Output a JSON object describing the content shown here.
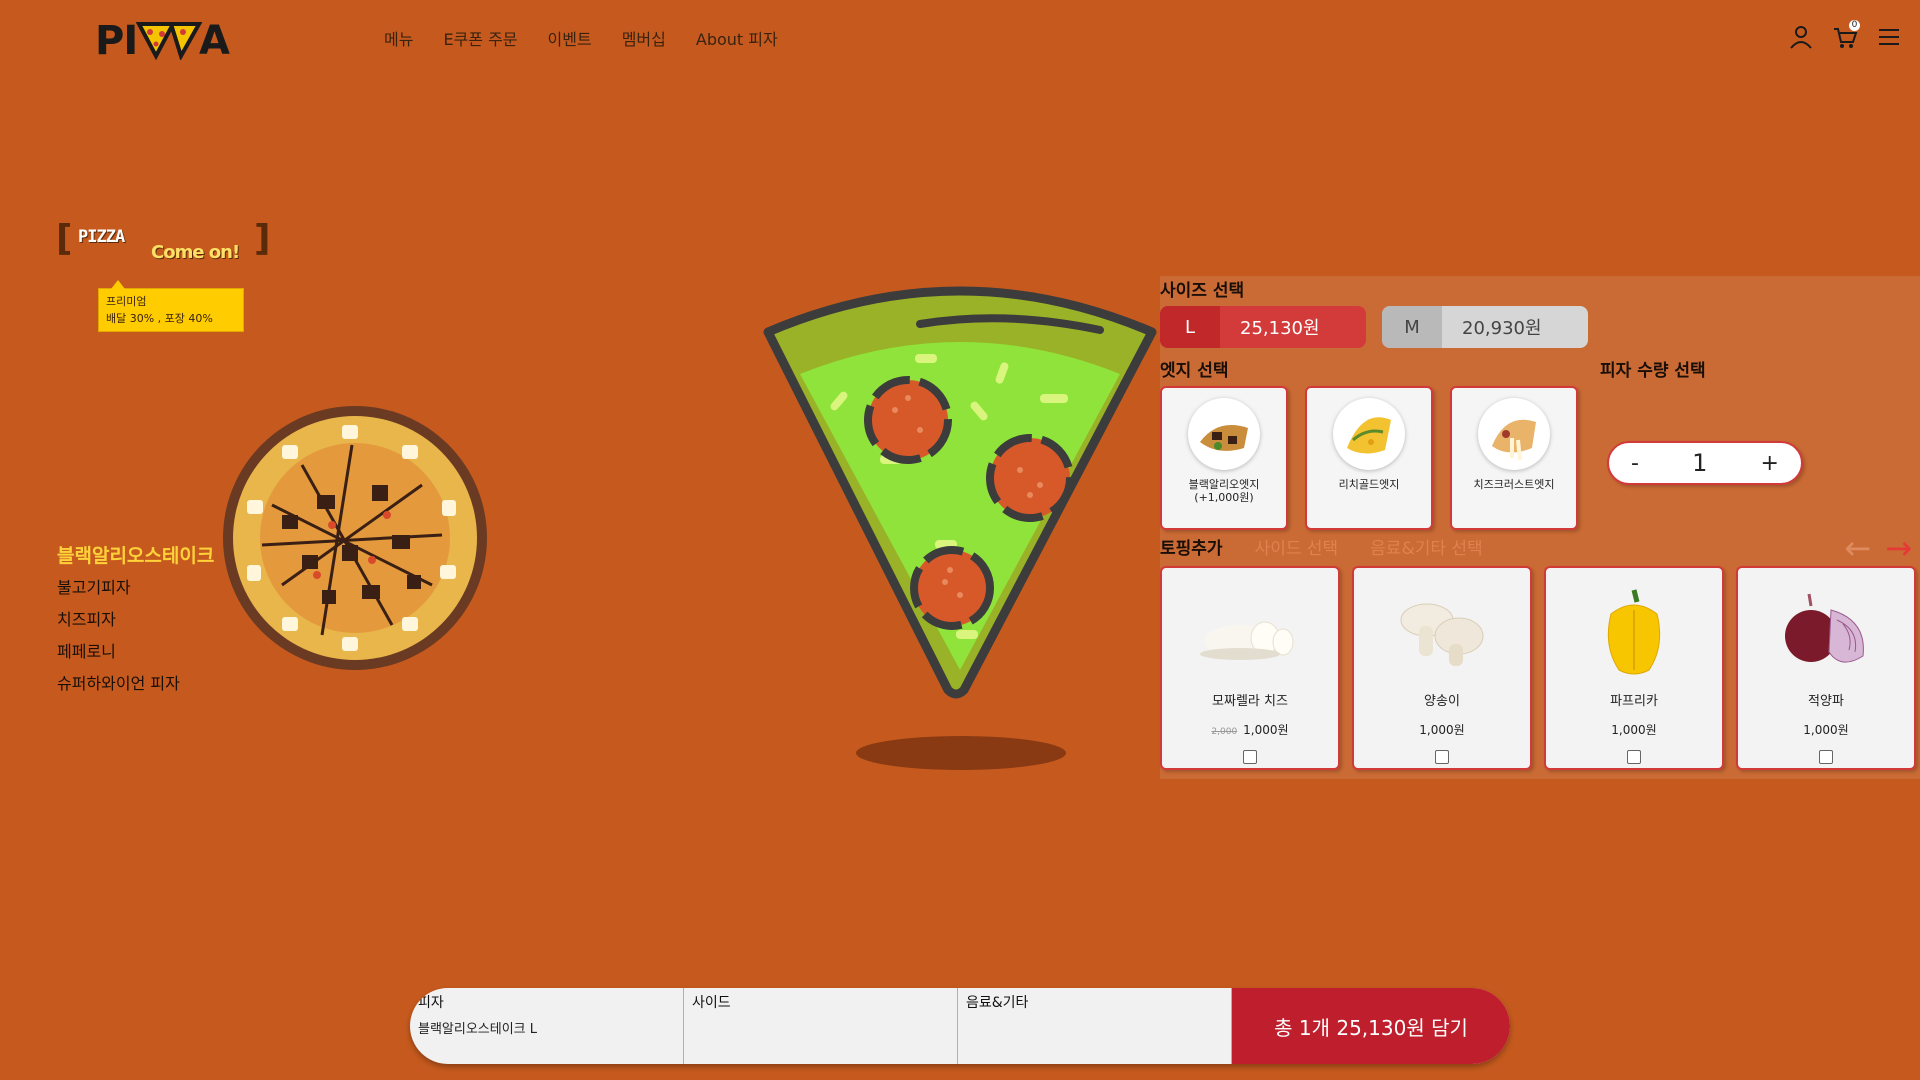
{
  "header": {
    "logo_text": "PIZZA",
    "nav": [
      "메뉴",
      "E쿠폰 주문",
      "이벤트",
      "멤버십",
      "About 피자"
    ],
    "cart_count": "0"
  },
  "promo": {
    "label_pizza": "PIZZA",
    "label_come": "Come on!",
    "tooltip_line1": "프리미엄",
    "tooltip_line2": "배달 30% , 포장 40%"
  },
  "pizza_list": [
    "블랙알리오스테이크",
    "불고기피자",
    "치즈피자",
    "페페로니",
    "슈퍼하와이언 피자"
  ],
  "size": {
    "title": "사이즈 선택",
    "options": [
      {
        "label": "L",
        "price": "25,130원"
      },
      {
        "label": "M",
        "price": "20,930원"
      }
    ]
  },
  "edge": {
    "title": "엣지 선택",
    "options": [
      {
        "name": "블랙알리오엣지",
        "extra": "(+1,000원)"
      },
      {
        "name": "리치골드엣지",
        "extra": ""
      },
      {
        "name": "치즈크러스트엣지",
        "extra": ""
      }
    ]
  },
  "quantity": {
    "title": "피자 수량 선택",
    "minus": "-",
    "value": "1",
    "plus": "+"
  },
  "tabs": [
    "토핑추가",
    "사이드 선택",
    "음료&기타 선택"
  ],
  "arrows": {
    "prev": "←",
    "next": "→"
  },
  "toppings": [
    {
      "name": "모짜렐라 치즈",
      "old_price": "2,000",
      "price": "1,000원"
    },
    {
      "name": "양송이",
      "old_price": "",
      "price": "1,000원"
    },
    {
      "name": "파프리카",
      "old_price": "",
      "price": "1,000원"
    },
    {
      "name": "적양파",
      "old_price": "",
      "price": "1,000원"
    }
  ],
  "order_bar": {
    "pizza_title": "피자",
    "pizza_value": "블랙알리오스테이크 L",
    "side_title": "사이드",
    "side_value": "",
    "drink_title": "음료&기타",
    "drink_value": "",
    "total_button": "총 1개 25,130원 담기"
  },
  "colors": {
    "background": "#c65a1e",
    "accent_red": "#bf1e2d",
    "highlight_yellow": "#ffd23a"
  }
}
